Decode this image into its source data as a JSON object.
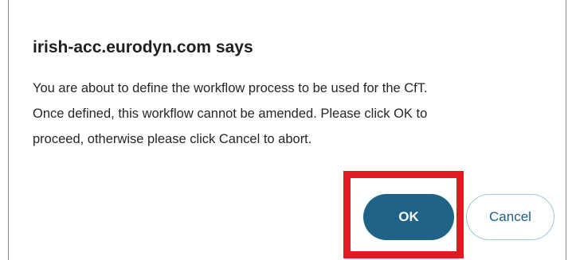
{
  "dialog": {
    "title": "irish-acc.eurodyn.com says",
    "message_lines": [
      "You are about to define the workflow process to be used for the CfT.",
      "Once defined, this workflow cannot be amended. Please click OK to",
      "proceed, otherwise please click Cancel to abort."
    ],
    "ok_label": "OK",
    "cancel_label": "Cancel"
  },
  "colors": {
    "ok_button_bg": "#1f6387",
    "cancel_text": "#1f5f86",
    "highlight_border": "#e01b22"
  }
}
